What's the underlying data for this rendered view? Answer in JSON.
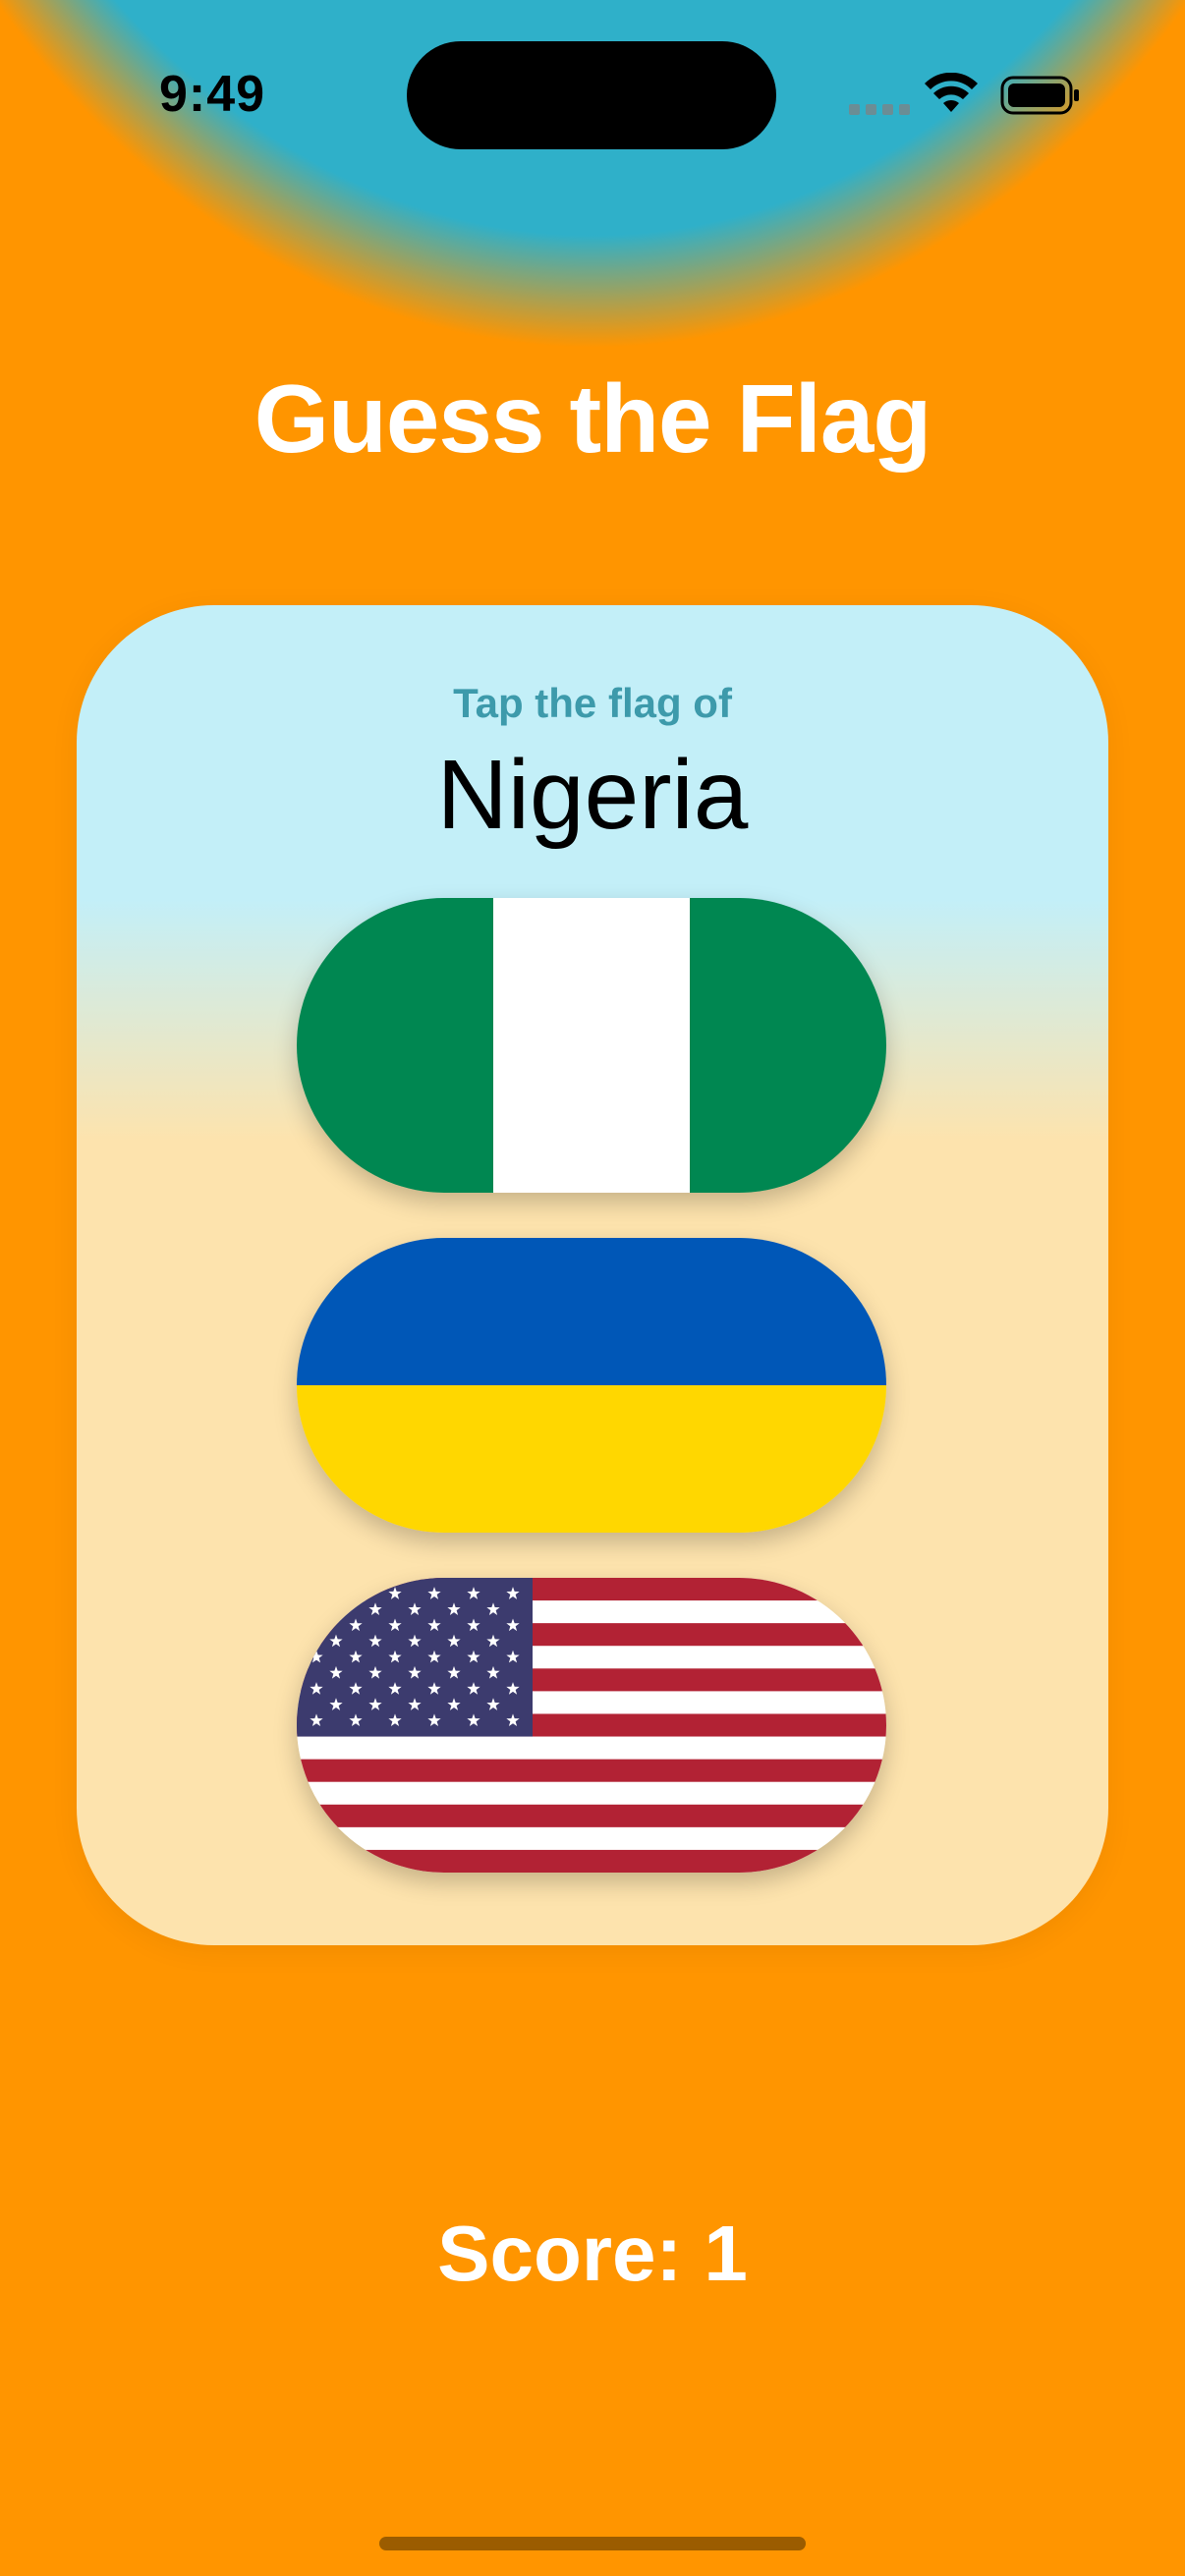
{
  "status_bar": {
    "time": "9:49"
  },
  "title": "Guess the Flag",
  "card": {
    "prompt": "Tap the flag of",
    "country": "Nigeria"
  },
  "flags": [
    {
      "country": "Nigeria",
      "icon": "nigeria-flag"
    },
    {
      "country": "Ukraine",
      "icon": "ukraine-flag"
    },
    {
      "country": "United States",
      "icon": "us-flag"
    }
  ],
  "score_label": "Score: 1",
  "colors": {
    "top_background": "#2fb0c9",
    "bottom_background": "#ff9500",
    "prompt_text": "#3d9aab"
  }
}
